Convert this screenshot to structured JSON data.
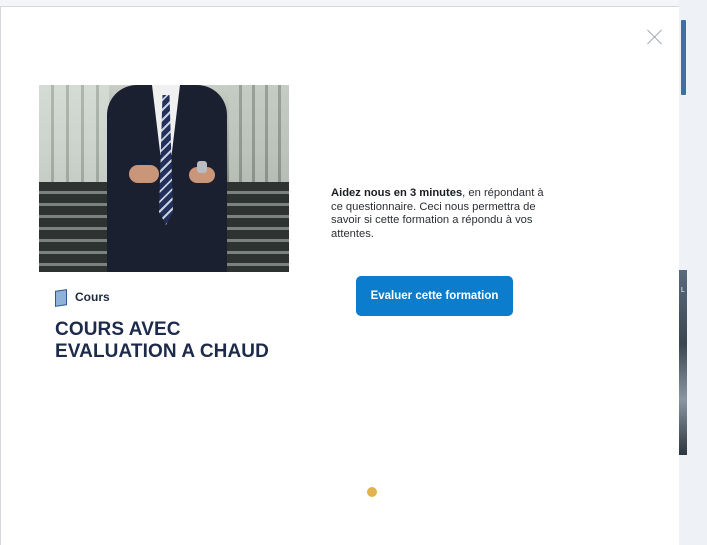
{
  "background": {
    "side_text": "L"
  },
  "modal": {
    "close_icon": "close-icon",
    "course": {
      "type_icon": "book-icon",
      "type_label": "Cours",
      "title": "COURS AVEC EVALUATION A CHAUD"
    },
    "message": {
      "bold": "Aidez nous en 3 minutes",
      "rest": ", en répondant à ce questionnaire. Ceci nous permettra de savoir si cette formation a répondu à vos attentes."
    },
    "evaluate_button_label": "Evaluer cette formation",
    "pager": {
      "pages": 1,
      "active_color": "#e3b350"
    }
  },
  "colors": {
    "accent": "#0c7dcc",
    "title": "#1d2a4a"
  }
}
